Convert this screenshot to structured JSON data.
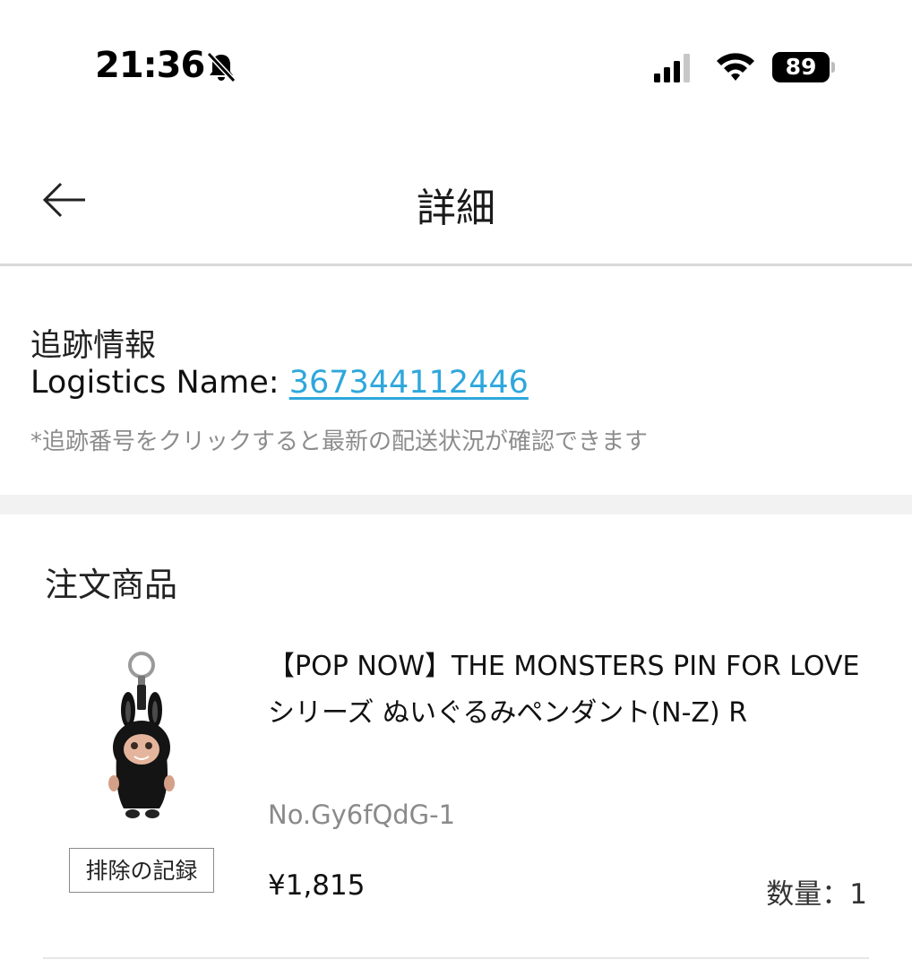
{
  "status_bar": {
    "time": "21:36",
    "battery": "89"
  },
  "header": {
    "title": "詳細"
  },
  "tracking": {
    "title": "追跡情報",
    "logistics_label": "Logistics Name: ",
    "tracking_number": "367344112446",
    "hint": "*追跡番号をクリックすると最新の配送状況が確認できます"
  },
  "order": {
    "title": "注文商品",
    "items": [
      {
        "name": "【POP NOW】THE MONSTERS PIN FOR LOVE シリーズ ぬいぐるみペンダント(N-Z) R",
        "sku": "No.Gy6fQdG-1",
        "price": "¥1,815",
        "quantity": "数量：1",
        "exclude_label": "排除の記録"
      }
    ]
  },
  "icons": {
    "back": "arrow-left-icon",
    "silent": "bell-slash-icon",
    "signal": "cellular-signal-icon",
    "wifi": "wifi-icon",
    "product": "labubu-plush-pendant-image"
  },
  "colors": {
    "link": "#2ea7dc",
    "muted": "#8c8c8c",
    "section_gap": "#f2f2f2"
  }
}
